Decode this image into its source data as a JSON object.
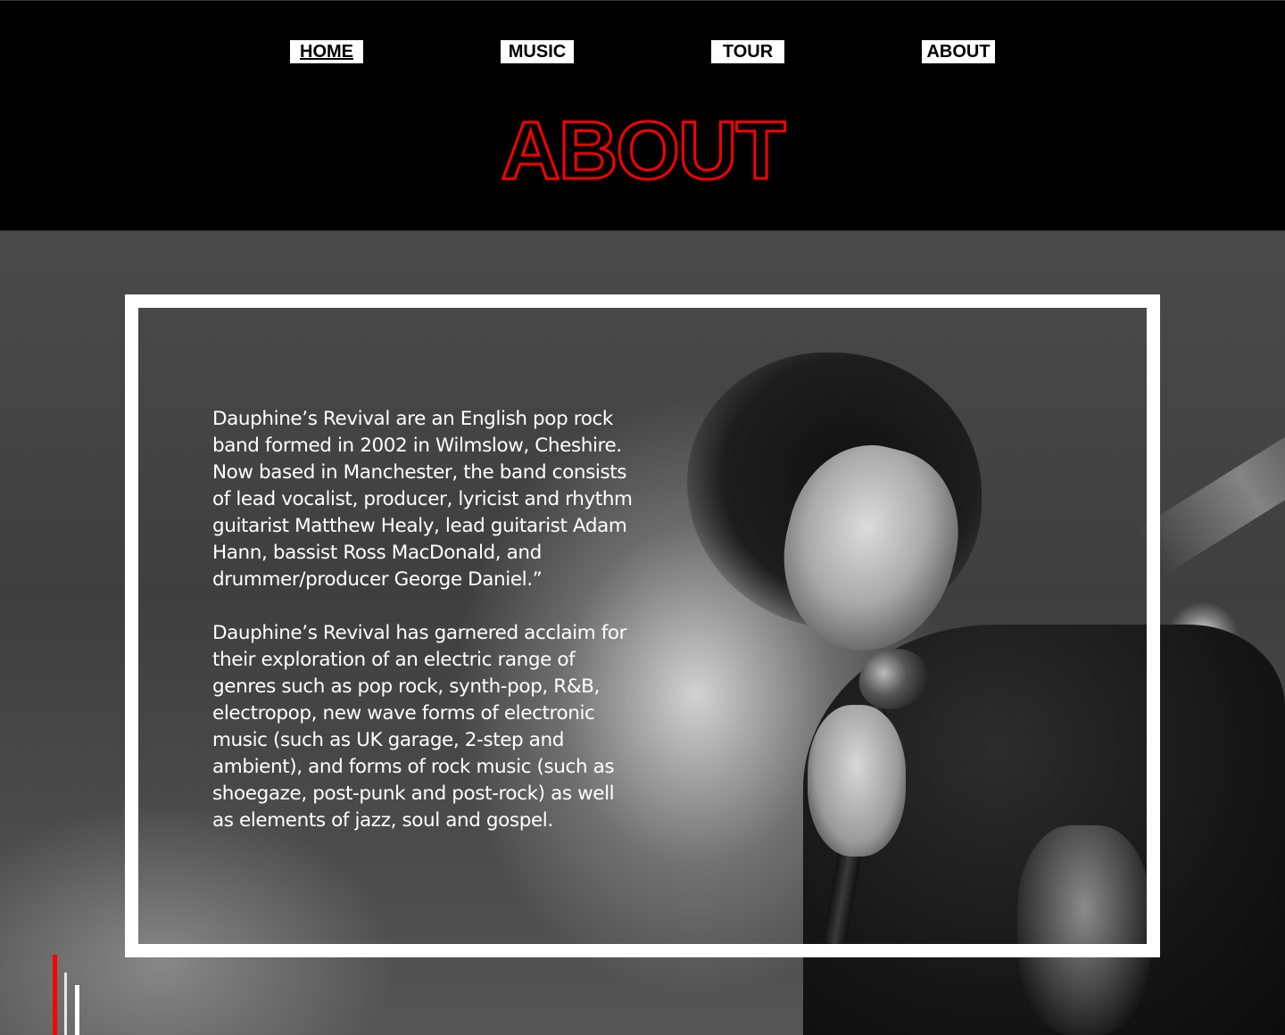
{
  "nav": {
    "items": [
      {
        "label": "HOME",
        "active": true
      },
      {
        "label": "MUSIC",
        "active": false
      },
      {
        "label": "TOUR",
        "active": false
      },
      {
        "label": "ABOUT",
        "active": false
      }
    ]
  },
  "page": {
    "title": "ABOUT",
    "title_stroke_color": "#ff0000"
  },
  "about": {
    "paragraphs": [
      "Dauphine’s Revival are an English pop rock band formed in 2002 in Wilmslow, Cheshire. Now based in Manchester, the band consists of lead vocalist, producer, lyricist and rhythm guitarist Matthew Healy, lead guitarist Adam Hann, bassist Ross MacDonald, and drummer/producer George Daniel.”",
      "Dauphine’s Revival has garnered acclaim for their exploration of an electric range of genres such as pop rock, synth-pop, R&B, electropop, new wave forms of electronic music (such as UK garage, 2-step and ambient), and forms of rock music (such as shoegaze, post-punk and post-rock) as well as elements of jazz, soul and gospel."
    ]
  },
  "colors": {
    "accent": "#ff0000",
    "header_bg": "#000000",
    "frame": "#ffffff"
  }
}
